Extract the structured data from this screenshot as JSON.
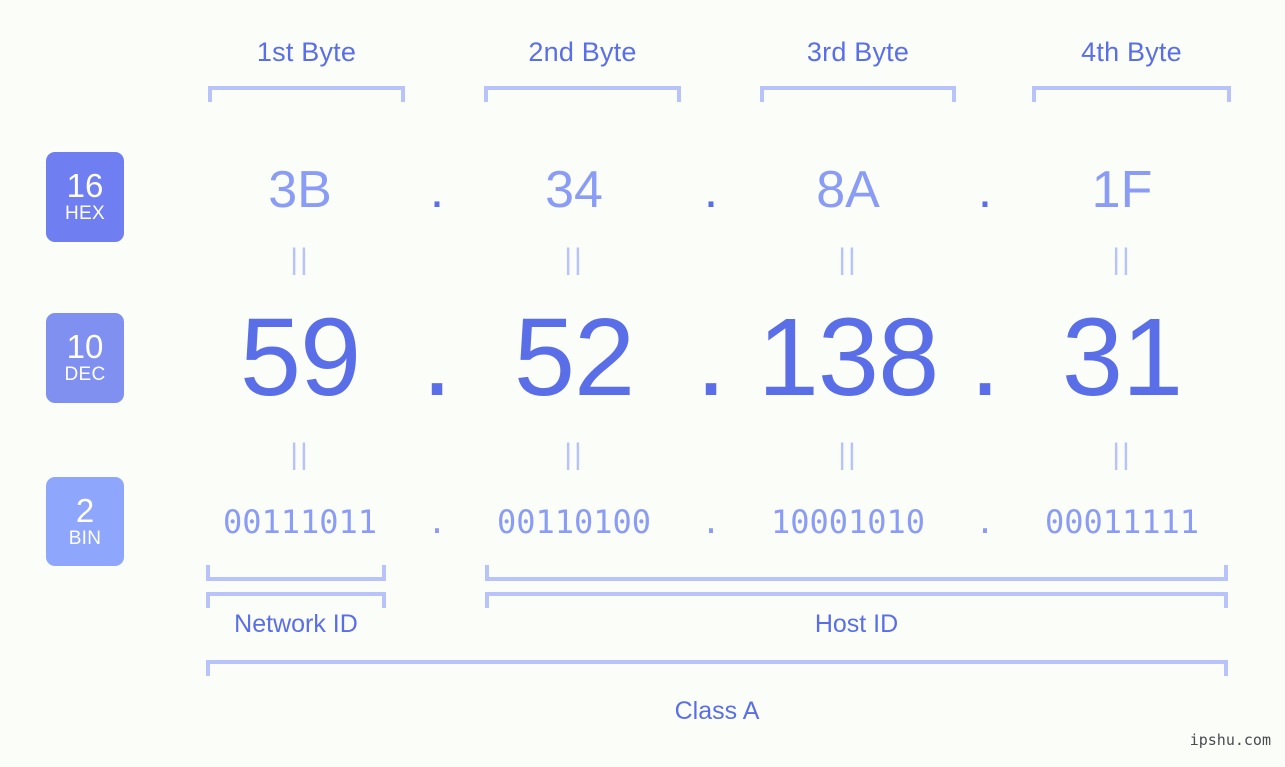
{
  "background": "#fbfdf8",
  "colors": {
    "accent_strong": "#5a6ee8",
    "accent_light": "#8a9cf5",
    "bracket": "#b9c3fb",
    "badge_hex": "#6f7ef0",
    "badge_dec": "#8090f0",
    "badge_bin": "#8ea6fb"
  },
  "byte_headers": [
    {
      "label": "1st Byte"
    },
    {
      "label": "2nd Byte"
    },
    {
      "label": "3rd Byte"
    },
    {
      "label": "4th Byte"
    }
  ],
  "bases": [
    {
      "radix": "16",
      "name": "HEX"
    },
    {
      "radix": "10",
      "name": "DEC"
    },
    {
      "radix": "2",
      "name": "BIN"
    }
  ],
  "rows": {
    "hex": {
      "values": [
        "3B",
        "34",
        "8A",
        "1F"
      ],
      "separator": "."
    },
    "dec": {
      "values": [
        "59",
        "52",
        "138",
        "31"
      ],
      "separator": "."
    },
    "bin": {
      "values": [
        "00111011",
        "00110100",
        "10001010",
        "00011111"
      ],
      "separator": "."
    }
  },
  "equals_marks": {
    "glyph": "||"
  },
  "zones": [
    {
      "label": "Network ID"
    },
    {
      "label": "Host ID"
    }
  ],
  "class_label": "Class A",
  "watermark": "ipshu.com",
  "chart_data": {
    "type": "table",
    "title": "IPv4 address 59.52.138.31 byte breakdown",
    "columns": [
      "1st Byte",
      "2nd Byte",
      "3rd Byte",
      "4th Byte"
    ],
    "rows": [
      {
        "name": "HEX",
        "radix": 16,
        "values": [
          "3B",
          "34",
          "8A",
          "1F"
        ]
      },
      {
        "name": "DEC",
        "radix": 10,
        "values": [
          "59",
          "52",
          "138",
          "31"
        ]
      },
      {
        "name": "BIN",
        "radix": 2,
        "values": [
          "00111011",
          "00110100",
          "10001010",
          "00011111"
        ]
      }
    ],
    "network_id_bytes": 1,
    "host_id_bytes": 3,
    "address_class": "Class A",
    "dotted_decimal": "59.52.138.31"
  }
}
